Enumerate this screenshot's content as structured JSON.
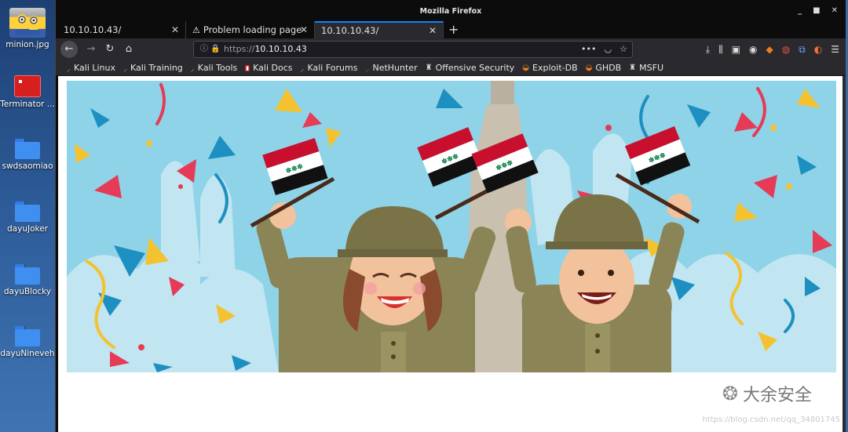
{
  "desktop": {
    "icons": [
      {
        "label": "minion.jpg",
        "kind": "image"
      },
      {
        "label": "Terminator ...",
        "kind": "terminal"
      },
      {
        "label": "swdsaomiao",
        "kind": "folder"
      },
      {
        "label": "dayuJoker",
        "kind": "folder"
      },
      {
        "label": "dayuBlocky",
        "kind": "folder"
      },
      {
        "label": "dayuNineveh",
        "kind": "folder"
      }
    ]
  },
  "browser": {
    "window_title": "Mozilla Firefox",
    "tabs": [
      {
        "label": "10.10.10.43/",
        "active": false
      },
      {
        "label": "Problem loading page",
        "active": false,
        "icon": "warning-icon"
      },
      {
        "label": "10.10.10.43/",
        "active": true
      }
    ],
    "address": {
      "scheme": "https://",
      "host": "10.10.10.43"
    },
    "bookmarks": [
      {
        "label": "Kali Linux",
        "icon": "kali-icon"
      },
      {
        "label": "Kali Training",
        "icon": "kali-icon"
      },
      {
        "label": "Kali Tools",
        "icon": "kali-icon"
      },
      {
        "label": "Kali Docs",
        "icon": "kali-docs-icon"
      },
      {
        "label": "Kali Forums",
        "icon": "kali-icon"
      },
      {
        "label": "NetHunter",
        "icon": "nethunter-icon"
      },
      {
        "label": "Offensive Security",
        "icon": "offsec-icon"
      },
      {
        "label": "Exploit-DB",
        "icon": "exploitdb-icon"
      },
      {
        "label": "GHDB",
        "icon": "exploitdb-icon"
      },
      {
        "label": "MSFU",
        "icon": "offsec-icon"
      }
    ]
  },
  "page": {
    "watermark_text": "大余安全",
    "watermark_url": "https://blog.csdn.net/qq_34801745"
  },
  "colors": {
    "sky": "#8ed3e8",
    "uniform": "#8b8456",
    "flag_red": "#c8102e",
    "flag_green": "#007a3d",
    "accent_blue": "#0a84ff"
  }
}
